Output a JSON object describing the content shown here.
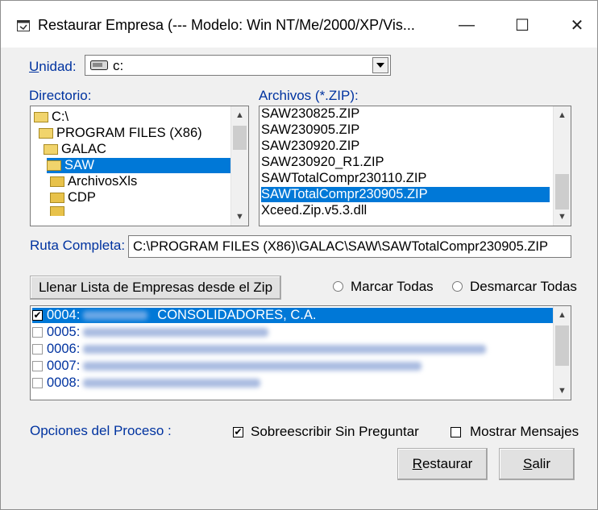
{
  "window": {
    "title": "Restaurar Empresa  (--- Modelo: Win NT/Me/2000/XP/Vis...",
    "minimize": "—",
    "maximize": "☐",
    "close": "✕"
  },
  "unidad": {
    "label": "Unidad:",
    "value": "c:"
  },
  "directorio": {
    "label": "Directorio:",
    "items": [
      "C:\\",
      "PROGRAM FILES (X86)",
      "GALAC",
      "SAW",
      "ArchivosXls",
      "CDP"
    ],
    "selected": "SAW"
  },
  "archivos": {
    "label": "Archivos (*.ZIP):",
    "items": [
      "SAW230825.ZIP",
      "SAW230905.ZIP",
      "SAW230920.ZIP",
      "SAW230920_R1.ZIP",
      "SAWTotalCompr230110.ZIP",
      "SAWTotalCompr230905.ZIP",
      "Xceed.Zip.v5.3.dll"
    ],
    "selected": "SAWTotalCompr230905.ZIP"
  },
  "ruta": {
    "label": "Ruta Completa:",
    "value": "C:\\PROGRAM FILES (X86)\\GALAC\\SAW\\SAWTotalCompr230905.ZIP"
  },
  "llenar_button": "Llenar Lista de Empresas desde el Zip",
  "marcar_todas": "Marcar Todas",
  "desmarcar_todas": "Desmarcar Todas",
  "empresas": [
    {
      "code": "0004:",
      "name": "CONSOLIDADORES, C.A.",
      "checked": true
    },
    {
      "code": "0005:",
      "name": "",
      "checked": false
    },
    {
      "code": "0006:",
      "name": "",
      "checked": false
    },
    {
      "code": "0007:",
      "name": "",
      "checked": false
    },
    {
      "code": "0008:",
      "name": "",
      "checked": false
    }
  ],
  "opciones": {
    "label": "Opciones del Proceso :",
    "sobreescribir": {
      "label": "Sobreescribir Sin Preguntar",
      "checked": true
    },
    "mostrar": {
      "label": "Mostrar Mensajes",
      "checked": false
    }
  },
  "buttons": {
    "restaurar": "Restaurar",
    "salir": "Salir"
  },
  "colors": {
    "selection": "#0078d7",
    "label_blue": "#0033a0"
  }
}
